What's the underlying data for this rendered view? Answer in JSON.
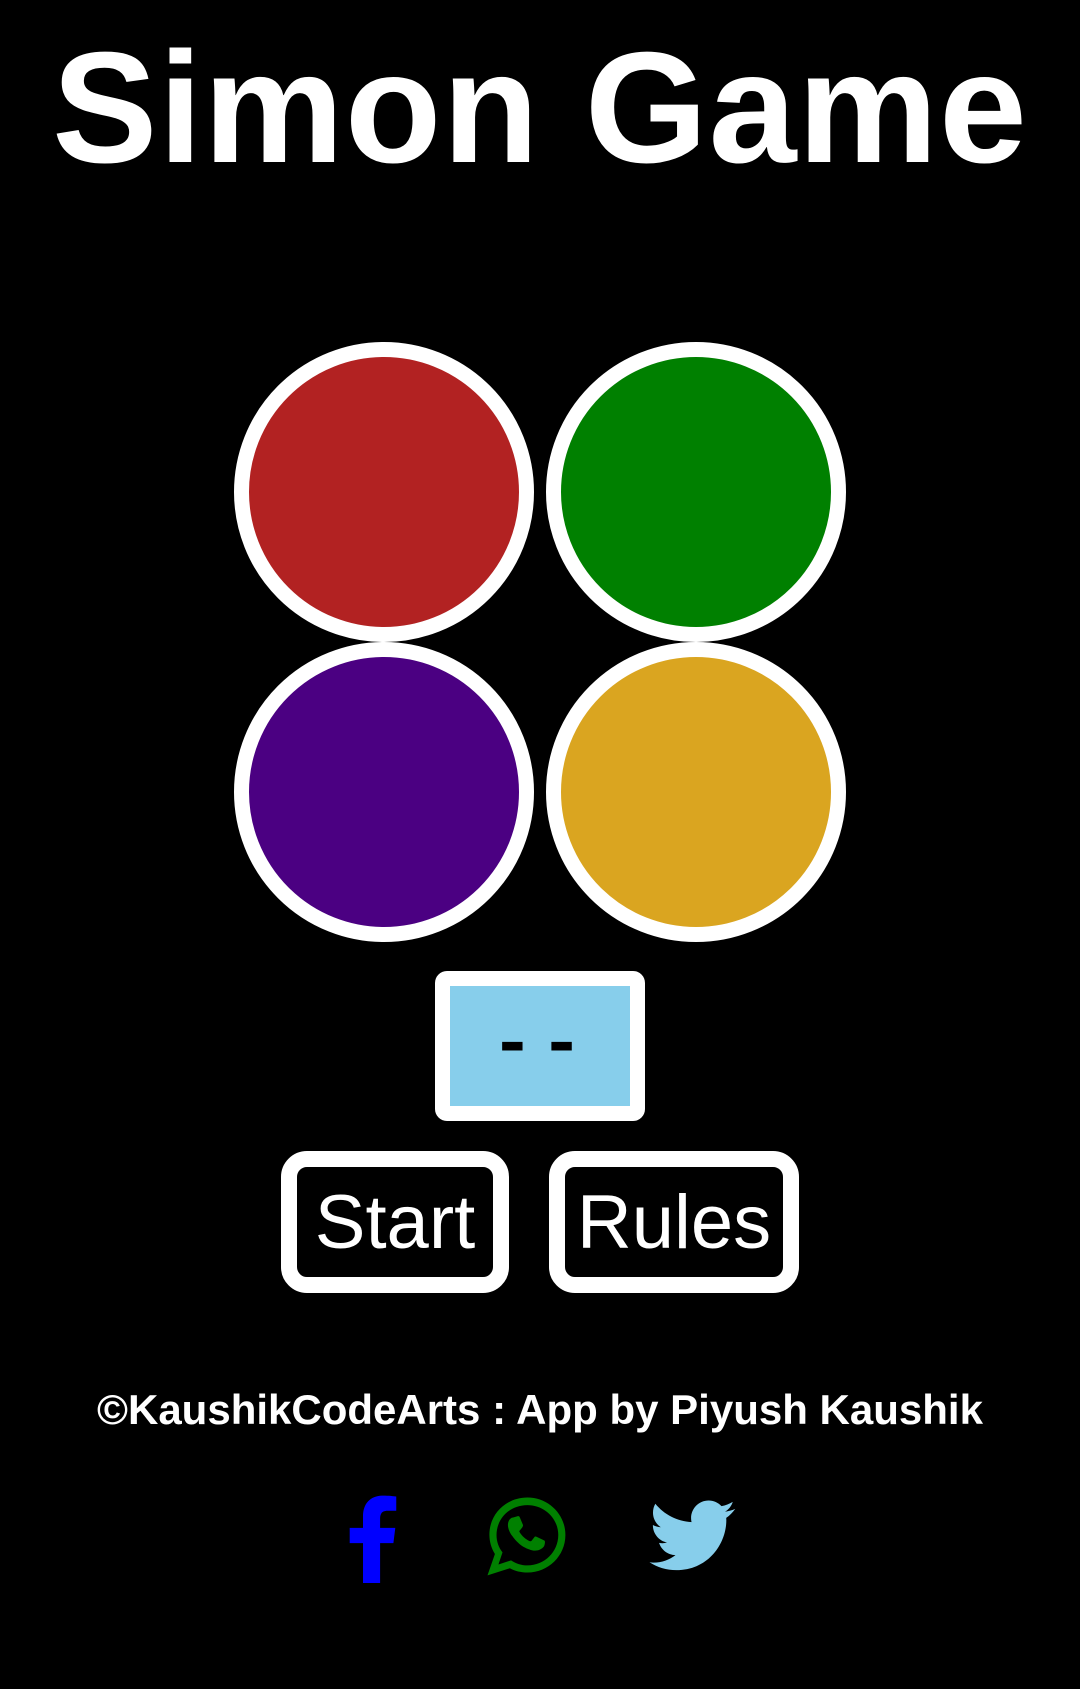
{
  "header": {
    "title": "Simon Game"
  },
  "pads": [
    {
      "name": "red-pad",
      "color": "#B22222"
    },
    {
      "name": "green-pad",
      "color": "#008000"
    },
    {
      "name": "purple-pad",
      "color": "#4B0082"
    },
    {
      "name": "yellow-pad",
      "color": "#DAA520"
    }
  ],
  "score": {
    "value": "--",
    "background": "#87CEEB"
  },
  "controls": {
    "start_label": "Start",
    "rules_label": "Rules"
  },
  "footer": {
    "credit": "©KaushikCodeArts : App by Piyush Kaushik"
  },
  "social": [
    {
      "icon": "facebook-icon",
      "color": "#0000FF"
    },
    {
      "icon": "whatsapp-icon",
      "color": "#008000"
    },
    {
      "icon": "twitter-icon",
      "color": "#87CEEB"
    }
  ]
}
